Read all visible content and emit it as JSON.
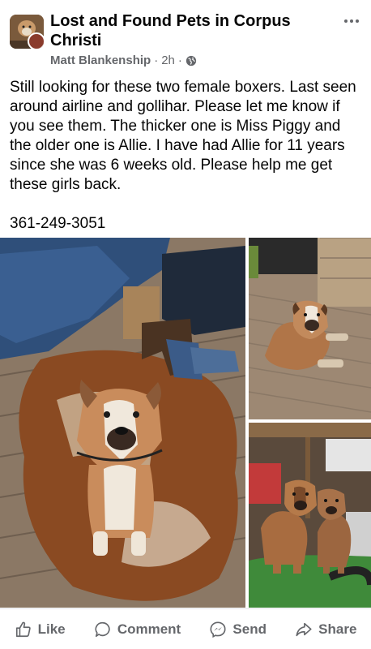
{
  "post": {
    "group_name": "Lost and Found Pets in Corpus Christi",
    "author": "Matt Blankenship",
    "time": "2h",
    "separator": "·",
    "privacy_icon": "globe-icon",
    "more_icon": "more-options-icon",
    "body": "Still looking for these two female boxers. Last seen around airline and gollihar. Please let me know if you see them. The thicker one is Miss Piggy and the older one is Allie. I have had Allie for 11 years since she was 6 weeks old. Please help me get these girls back.",
    "phone": "361-249-3051"
  },
  "photos": [
    {
      "subject": "boxer dog sitting on cowhide rug",
      "icon": "photo"
    },
    {
      "subject": "boxer dog lying on wooden deck",
      "icon": "photo"
    },
    {
      "subject": "two boxer dogs sitting on artificial grass",
      "icon": "photo"
    }
  ],
  "actions": {
    "like": "Like",
    "comment": "Comment",
    "send": "Send",
    "share": "Share"
  },
  "colors": {
    "text": "#050505",
    "secondary": "#65676b",
    "divider": "#e4e6eb"
  }
}
